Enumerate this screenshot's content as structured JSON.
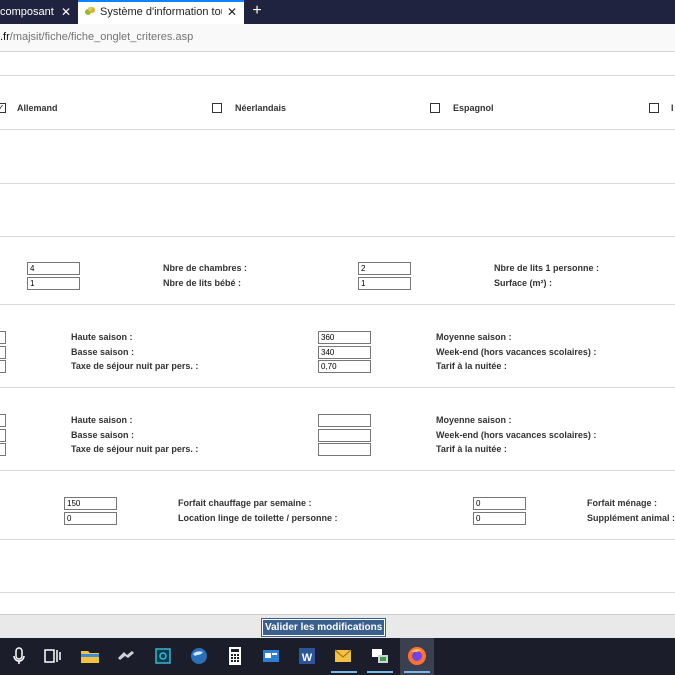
{
  "browser": {
    "tabs": [
      {
        "label": "composant Le"
      },
      {
        "label": "Système d'information touristique"
      }
    ],
    "new_tab": "+",
    "close": "✕",
    "url": {
      "domain": ".fr",
      "path": "/majsit/fiche/fiche_onglet_criteres.asp"
    }
  },
  "languages": {
    "items": [
      {
        "label": "Allemand",
        "checked": true
      },
      {
        "label": "Néerlandais",
        "checked": false
      },
      {
        "label": "Espagnol",
        "checked": false
      },
      {
        "label": "I",
        "checked": false
      }
    ]
  },
  "capacity": {
    "left_values": [
      "4",
      "1"
    ],
    "labels_a": [
      "Nbre de chambres :",
      "Nbre de lits bébé :"
    ],
    "values_b": [
      "2",
      "1"
    ],
    "labels_b": [
      "Nbre de lits 1 personne :",
      "Surface (m²) :"
    ]
  },
  "tarifs1": {
    "labels_a": [
      "Haute saison :",
      "Basse saison :",
      "Taxe de séjour nuit par pers. :"
    ],
    "values_b": [
      "360",
      "340",
      "0,70"
    ],
    "labels_b": [
      "Moyenne saison :",
      "Week-end (hors vacances scolaires) :",
      "Tarif à la nuitée :"
    ]
  },
  "tarifs2": {
    "labels_a": [
      "Haute saison :",
      "Basse saison :",
      "Taxe de séjour nuit par pers. :"
    ],
    "values_b": [
      "",
      "",
      ""
    ],
    "labels_b": [
      "Moyenne saison :",
      "Week-end (hors vacances scolaires) :",
      "Tarif à la nuitée :"
    ]
  },
  "extras": {
    "values_a": [
      "150",
      "0"
    ],
    "labels_a": [
      "Forfait chauffage par semaine :",
      "Location linge de toilette / personne :"
    ],
    "values_b": [
      "0",
      "0"
    ],
    "labels_b": [
      "Forfait ménage :",
      "Supplément animal :"
    ]
  },
  "submit_label": "Valider les modifications",
  "taskbar": {
    "icons": [
      "microphone-icon",
      "task-view-icon",
      "file-explorer-icon",
      "app-icon",
      "app-icon-2",
      "globe-icon",
      "calculator-icon",
      "window-icon",
      "word-icon",
      "mail-icon",
      "network-icon",
      "firefox-icon"
    ]
  }
}
